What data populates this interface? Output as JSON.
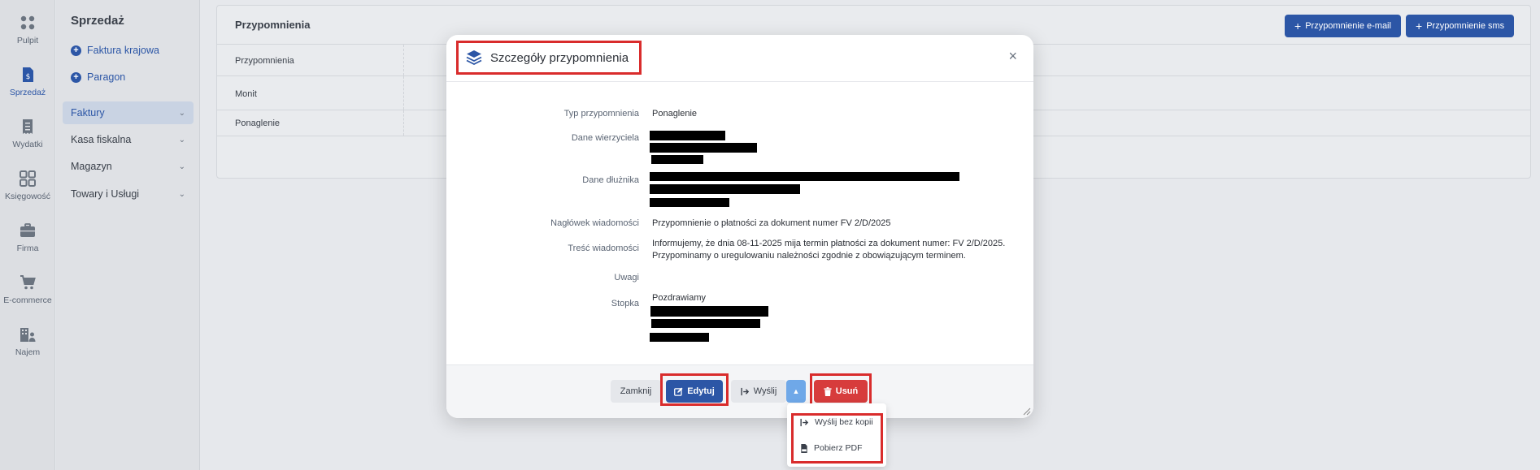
{
  "rail": {
    "items": [
      {
        "label": "Pulpit",
        "icon": "grid-icon"
      },
      {
        "label": "Sprzedaż",
        "icon": "invoice-icon"
      },
      {
        "label": "Wydatki",
        "icon": "receipt-icon"
      },
      {
        "label": "Księgowość",
        "icon": "apps-icon"
      },
      {
        "label": "Firma",
        "icon": "briefcase-icon"
      },
      {
        "label": "E-commerce",
        "icon": "cart-icon"
      },
      {
        "label": "Najem",
        "icon": "building-icon"
      }
    ],
    "active_color": "#2c56a6"
  },
  "sidebar": {
    "title": "Sprzedaż",
    "quick": [
      "Faktura krajowa",
      "Paragon"
    ],
    "nav": [
      "Faktury",
      "Kasa fiskalna",
      "Magazyn",
      "Towary i Usługi"
    ]
  },
  "content": {
    "title": "Przypomnienia",
    "btn_email": "Przypomnienie e-mail",
    "btn_sms": "Przypomnienie sms",
    "rows": [
      "Przypomnienia",
      "Monit",
      "Ponaglenie"
    ]
  },
  "modal": {
    "title": "Szczegóły przypomnienia",
    "close": "×",
    "fields": {
      "typ_label": "Typ przypomnienia",
      "typ_value": "Ponaglenie",
      "wierzyciel_label": "Dane wierzyciela",
      "dluznik_label": "Dane dłużnika",
      "naglowek_label": "Nagłówek wiadomości",
      "naglowek_value": "Przypomnienie o płatności za dokument numer FV 2/D/2025",
      "tresc_label": "Treść wiadomości",
      "tresc_line1": "Informujemy, że dnia 08-11-2025 mija termin płatności za dokument numer: FV 2/D/2025.",
      "tresc_line2": "Przypominamy o uregulowaniu należności zgodnie z obowiązującym terminem.",
      "uwagi_label": "Uwagi",
      "stopka_label": "Stopka",
      "stopka_value": "Pozdrawiamy"
    },
    "footer": {
      "zamknij": "Zamknij",
      "edytuj": "Edytuj",
      "wyslij": "Wyślij",
      "usun": "Usuń"
    }
  },
  "dropdown": {
    "items": [
      "Wyślij bez kopii",
      "Pobierz PDF"
    ]
  },
  "colors": {
    "primary": "#2c56a6",
    "danger": "#d73c3c",
    "highlight": "#d92c2c",
    "caret": "#6fa8e8"
  }
}
